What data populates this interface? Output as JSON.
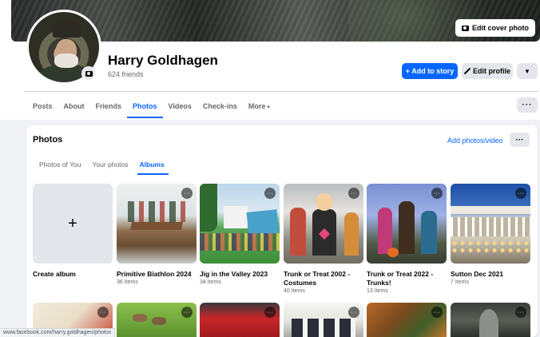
{
  "cover": {
    "edit_label": "Edit cover photo"
  },
  "profile": {
    "name": "Harry Goldhagen",
    "friends": "624 friends"
  },
  "actions": {
    "add_story": "+ Add to story",
    "edit_profile": "Edit profile",
    "more_icon": "chevron-down-icon"
  },
  "tabs": [
    {
      "label": "Posts"
    },
    {
      "label": "About"
    },
    {
      "label": "Friends"
    },
    {
      "label": "Photos",
      "active": true
    },
    {
      "label": "Videos"
    },
    {
      "label": "Check-ins"
    },
    {
      "label": "More"
    }
  ],
  "tabs_more_caret": "▾",
  "tabs_overflow": "···",
  "photos": {
    "title": "Photos",
    "add_label": "Add photos/video",
    "menu": "···",
    "subtabs": [
      "Photos of You",
      "Your photos",
      "Albums"
    ],
    "active_subtab": "Albums",
    "create_album": {
      "label": "Create album",
      "icon": "+"
    },
    "albums": [
      {
        "title": "Primitive Biathlon 2024",
        "count": "36 Items"
      },
      {
        "title": "Jig in the Valley 2023",
        "count": "34 Items"
      },
      {
        "title": "Trunk or Treat 2002 - Costumes",
        "count": "40 Items"
      },
      {
        "title": "Trunk or Treat 2022 - Trunks!",
        "count": "13 Items"
      },
      {
        "title": "Sutton Dec 2021",
        "count": "7 Items"
      }
    ],
    "album_menu": "···"
  },
  "status_url": "www.facebook.com/harry.goldhagen/photos",
  "colors": {
    "accent": "#0866ff",
    "secondary_button": "#e4e6eb",
    "page_bg": "#f0f2f5"
  }
}
